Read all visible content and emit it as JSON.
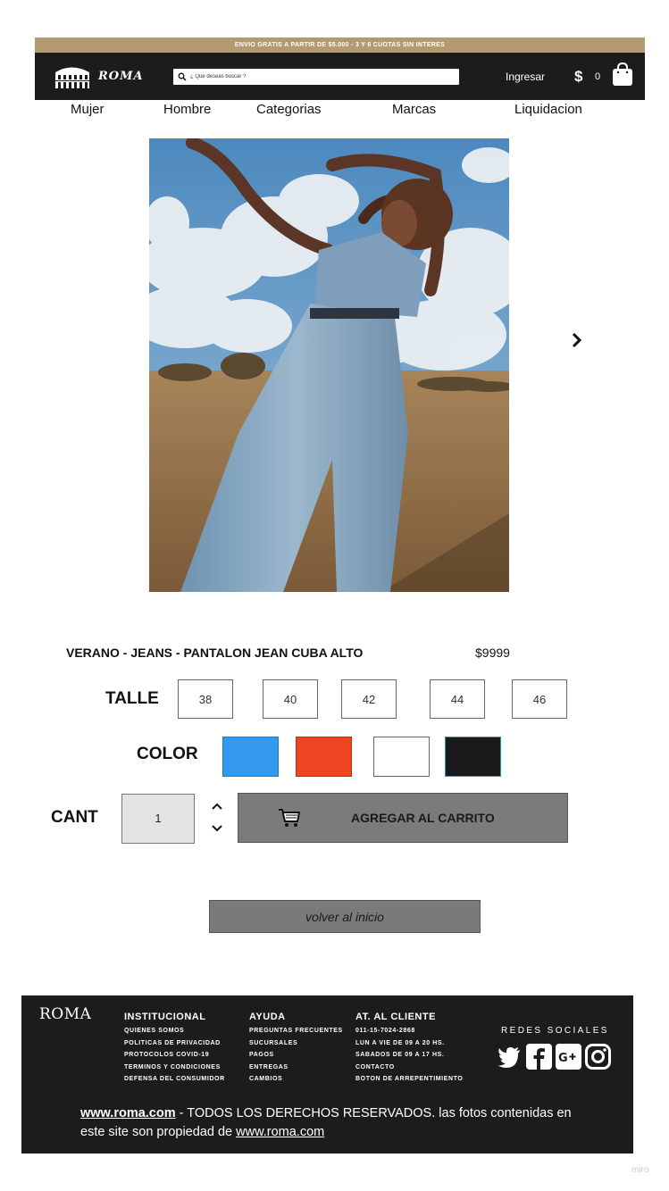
{
  "promo": {
    "text": "ENVIO GRATIS A PARTIR DE $5.000 - 3 Y 6 CUOTAS SIN INTERES"
  },
  "header": {
    "logo": "ROMA",
    "search_placeholder": "¿ Que deseas buscar ?",
    "login": "Ingresar",
    "currency": "$",
    "cart_count": "0"
  },
  "nav": {
    "items": [
      "Mujer",
      "Hombre",
      "Categorias",
      "Marcas",
      "Liquidacion"
    ]
  },
  "product": {
    "title": "VERANO - JEANS - PANTALON JEAN CUBA ALTO",
    "price": "$9999",
    "size_label": "TALLE",
    "sizes": [
      "38",
      "40",
      "42",
      "44",
      "46"
    ],
    "color_label": "COLOR",
    "colors": [
      "#3399ee",
      "#ee4422",
      "#ffffff",
      "#1a1a1a"
    ],
    "qty_label": "CANT",
    "qty": "1",
    "add_to_cart": "AGREGAR AL CARRITO"
  },
  "back_button": "volver al inicio",
  "footer": {
    "logo": "ROMA",
    "institucional": {
      "title": "INSTITUCIONAL",
      "links": [
        "QUIENES SOMOS",
        "POLITICAS DE PRIVACIDAD",
        "PROTOCOLOS COVID-19",
        "TERMINOS Y CONDICIONES",
        "DEFENSA DEL CONSUMIDOR"
      ]
    },
    "ayuda": {
      "title": "AYUDA",
      "links": [
        "PREGUNTAS FRECUENTES",
        "SUCURSALES",
        "PAGOS",
        "ENTREGAS",
        "CAMBIOS"
      ]
    },
    "cliente": {
      "title": "AT. AL CLIENTE",
      "links": [
        "011-15-7024-2868",
        "LUN A VIE DE 09 A 20 HS.",
        "SABADOS DE 09 A 17 HS.",
        "CONTACTO",
        "BOTON DE ARREPENTIMIENTO"
      ]
    },
    "social_title": "REDES SOCIALES",
    "copyright_link": "www.roma.com",
    "copyright_text": " - TODOS LOS DERECHOS RESERVADOS. las fotos contenidas en este site son propiedad de ",
    "copyright_link2": "www.roma.com"
  },
  "watermark": "miro"
}
